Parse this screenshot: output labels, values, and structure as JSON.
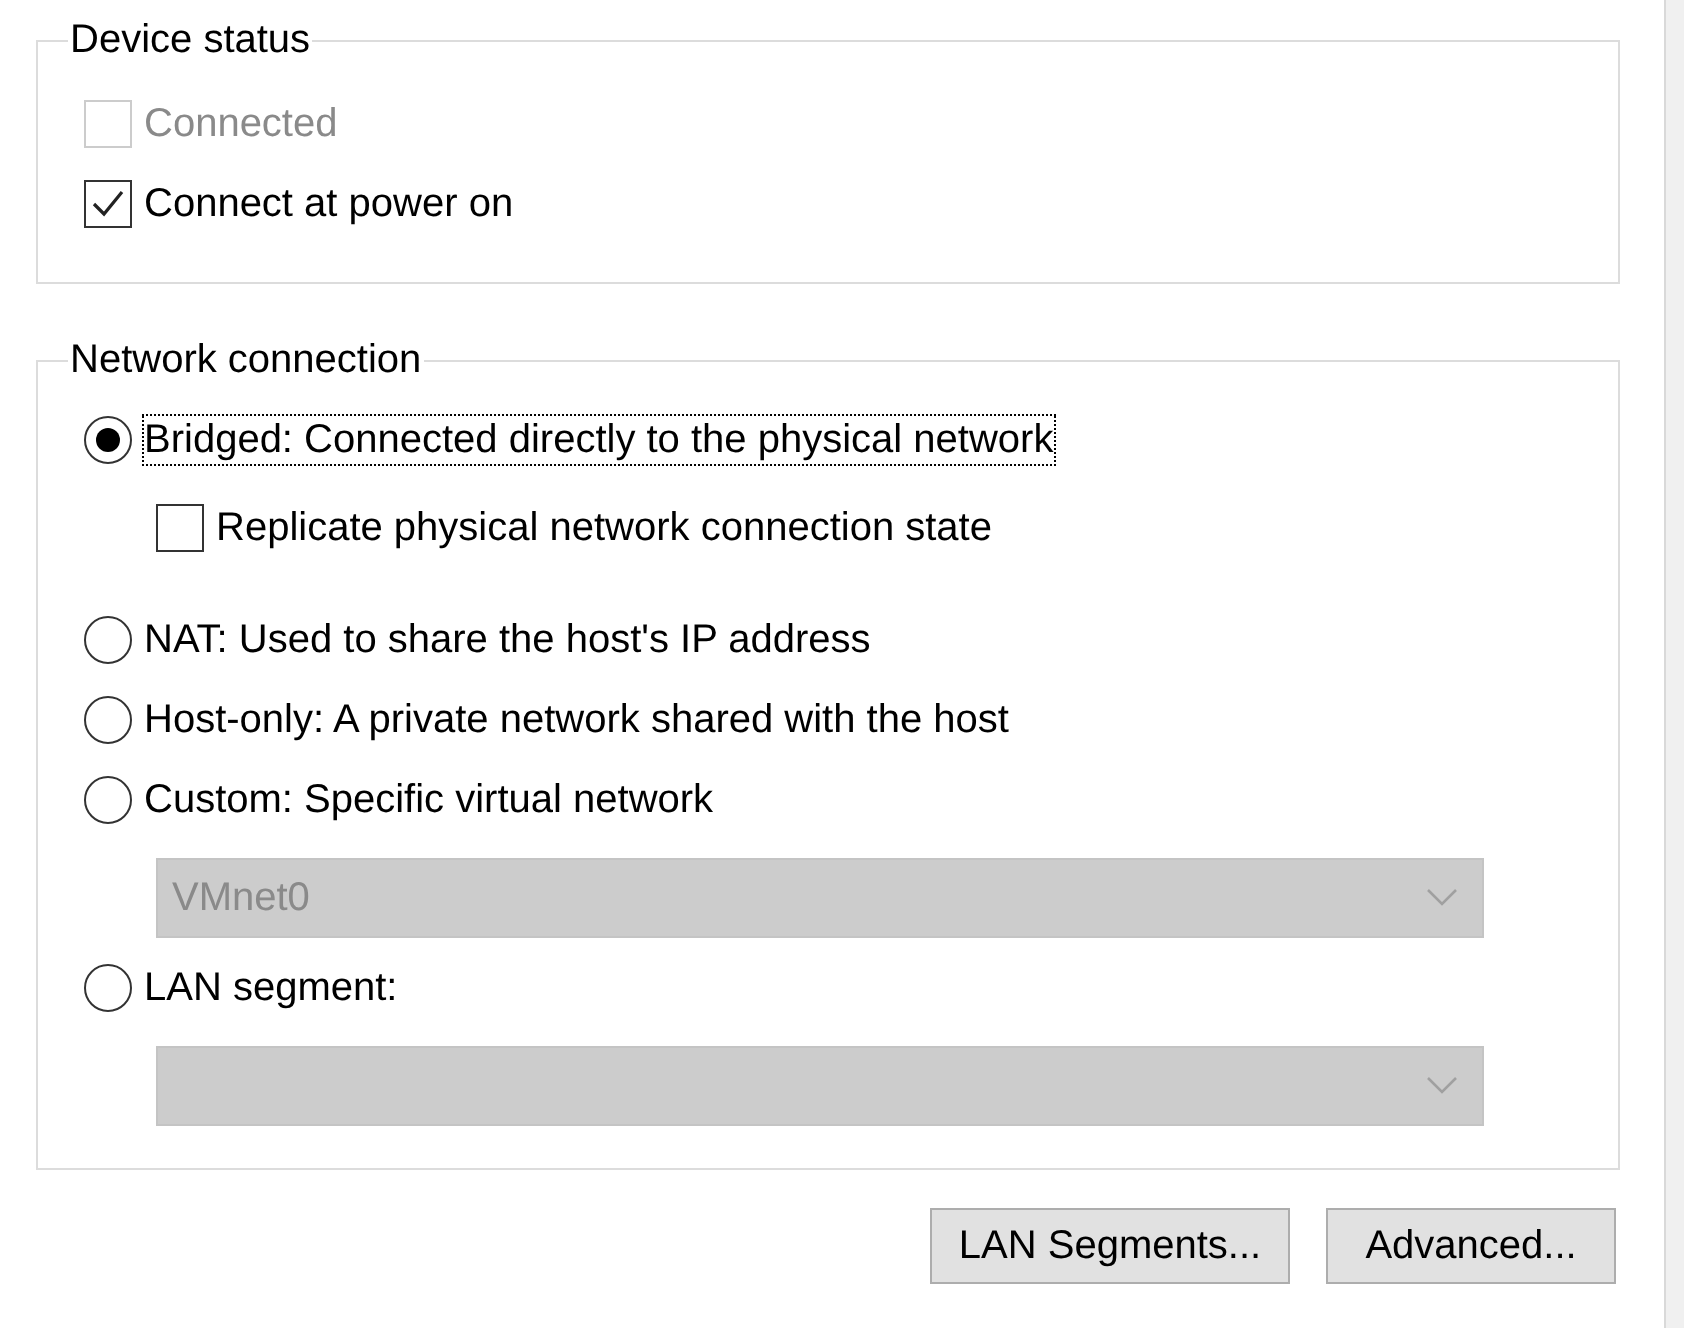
{
  "device_status": {
    "title": "Device status",
    "options": [
      {
        "label": "Connected",
        "checked": false,
        "disabled": true
      },
      {
        "label": "Connect at power on",
        "checked": true,
        "disabled": false
      }
    ]
  },
  "network_connection": {
    "title": "Network connection",
    "options": [
      {
        "kind": "radio",
        "label": "Bridged: Connected directly to the physical network",
        "selected": true,
        "focused": true
      },
      {
        "kind": "checkbox",
        "label": "Replicate physical network connection state",
        "checked": false
      },
      {
        "kind": "radio",
        "label": "NAT: Used to share the host's IP address",
        "selected": false,
        "focused": false
      },
      {
        "kind": "radio",
        "label": "Host-only: A private network shared with the host",
        "selected": false,
        "focused": false
      },
      {
        "kind": "radio",
        "label": "Custom: Specific virtual network",
        "selected": false,
        "focused": false
      },
      {
        "kind": "dropdown",
        "value": "VMnet0",
        "disabled": true
      },
      {
        "kind": "radio",
        "label": "LAN segment:",
        "selected": false,
        "focused": false
      },
      {
        "kind": "dropdown",
        "disabled": true
      }
    ]
  },
  "buttons": [
    "LAN Segments...",
    "Advanced..."
  ]
}
